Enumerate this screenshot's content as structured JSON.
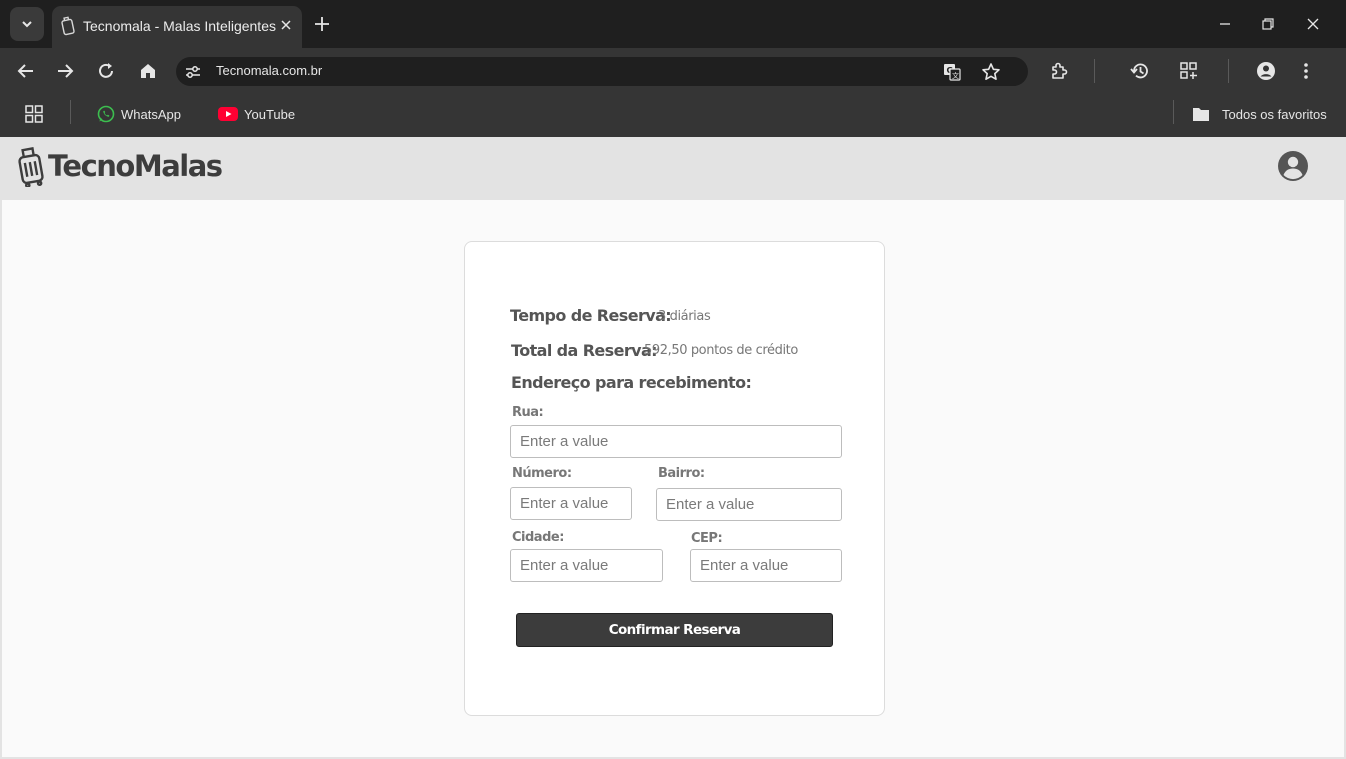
{
  "browser": {
    "tab": {
      "title": "Tecnomala - Malas Inteligentes"
    },
    "address_bar": {
      "url": "Tecnomala.com.br"
    },
    "bookmarks": [
      {
        "label": "WhatsApp"
      },
      {
        "label": "YouTube"
      }
    ],
    "all_bookmarks_label": "Todos os favoritos"
  },
  "site": {
    "logo_text": "TecnoMalas"
  },
  "reservation": {
    "time_label": "Tempo de Reserva:",
    "time_value": "3 diárias",
    "total_label": "Total da Reserva:",
    "total_value": "592,50 pontos de crédito",
    "address_heading": "Endereço para recebimento:",
    "fields": {
      "rua": {
        "label": "Rua:",
        "placeholder": "Enter a value"
      },
      "numero": {
        "label": "Número:",
        "placeholder": "Enter a value"
      },
      "bairro": {
        "label": "Bairro:",
        "placeholder": "Enter a value"
      },
      "cidade": {
        "label": "Cidade:",
        "placeholder": "Enter a value"
      },
      "cep": {
        "label": "CEP:",
        "placeholder": "Enter a value"
      }
    },
    "confirm_label": "Confirmar Reserva"
  }
}
